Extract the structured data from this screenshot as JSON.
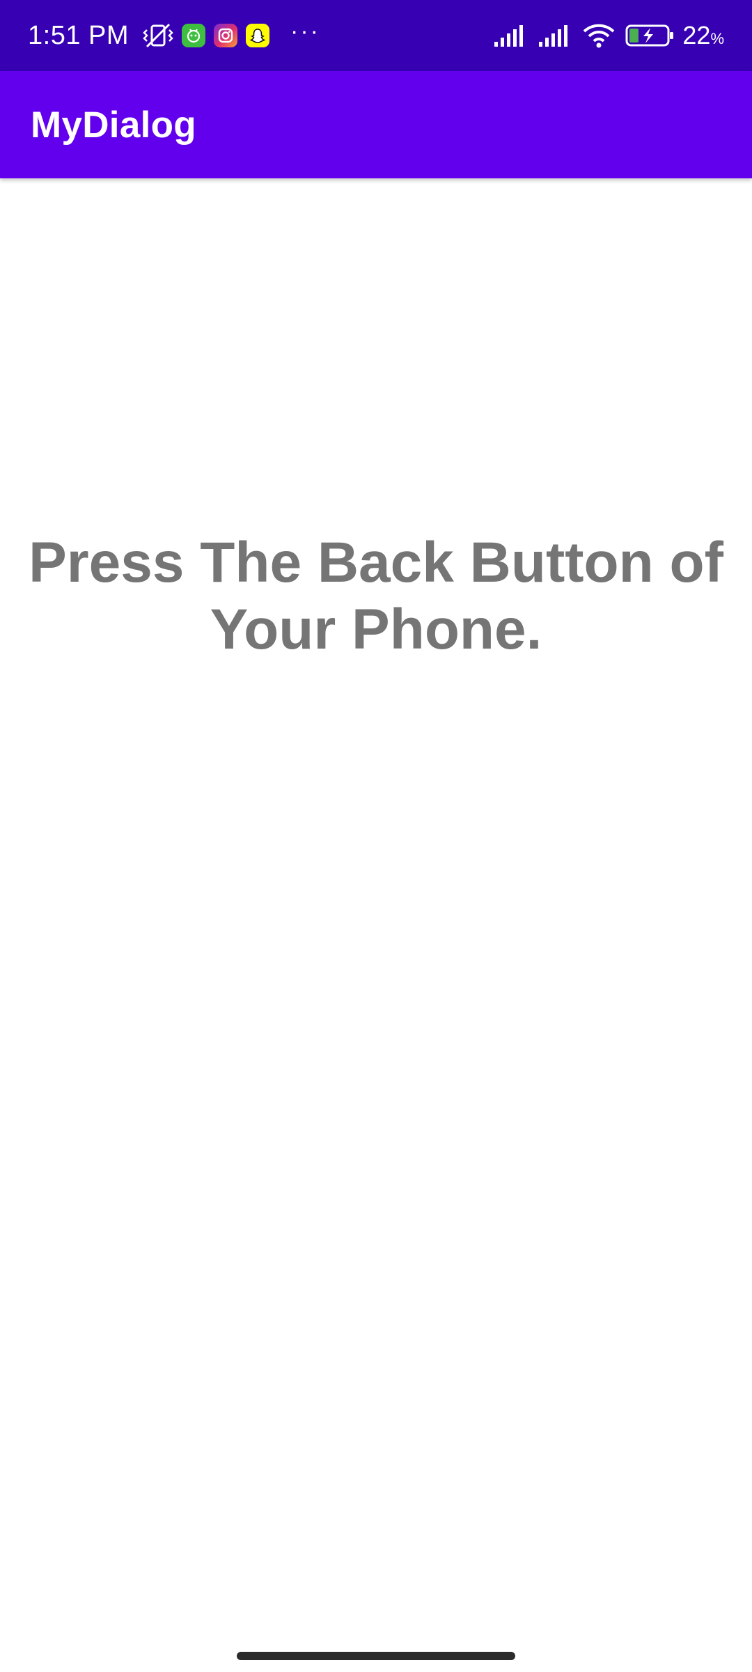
{
  "status_bar": {
    "time": "1:51 PM",
    "icons_left": [
      "vibrate-off-icon",
      "android-app-icon",
      "instagram-icon",
      "snapchat-icon"
    ],
    "overflow": "···",
    "icons_right": [
      "signal-sim1-icon",
      "signal-sim2-icon",
      "wifi-icon",
      "battery-charging-icon"
    ],
    "battery_value": "22",
    "battery_unit": "%",
    "background_color": "#3700b3"
  },
  "app_bar": {
    "title": "MyDialog",
    "background_color": "#6200ee"
  },
  "content": {
    "message": "Press The Back Button of Your Phone.",
    "text_color": "#757575"
  }
}
